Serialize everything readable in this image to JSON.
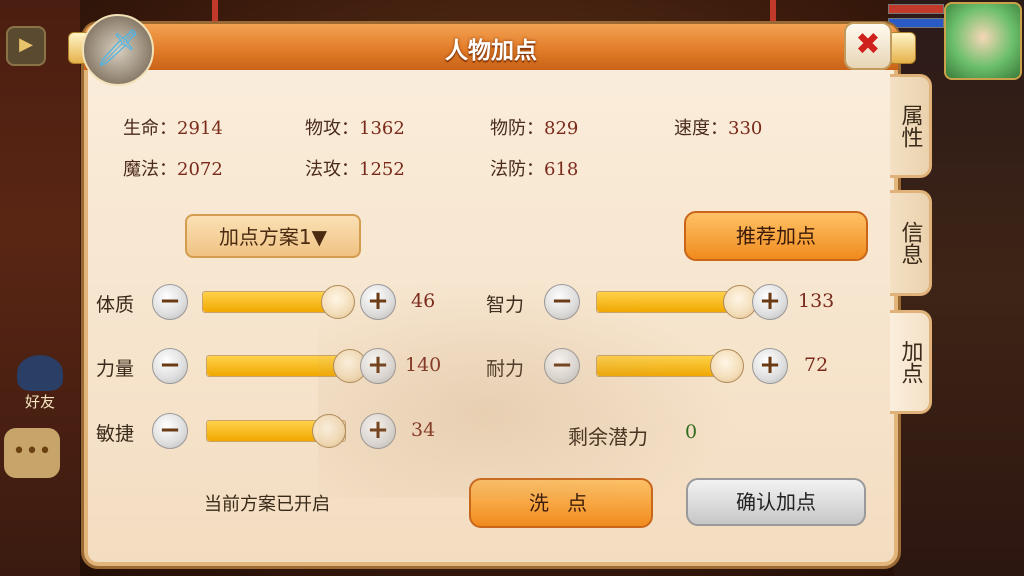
{
  "window": {
    "title": "人物加点"
  },
  "stats": [
    {
      "label": "生命：",
      "value": "2914"
    },
    {
      "label": "物攻：",
      "value": "1362"
    },
    {
      "label": "物防：",
      "value": "829"
    },
    {
      "label": "速度：",
      "value": "330"
    },
    {
      "label": "魔法：",
      "value": "2072"
    },
    {
      "label": "法攻：",
      "value": "1252"
    },
    {
      "label": "法防：",
      "value": "618"
    }
  ],
  "buttons": {
    "plan": "加点方案1▼",
    "recommend": "推荐加点",
    "wash": "洗 点",
    "confirm": "确认加点"
  },
  "attributes": [
    {
      "label": "体质",
      "value": "46",
      "fill": 0.92
    },
    {
      "label": "力量",
      "value": "140",
      "fill": 0.96
    },
    {
      "label": "敏捷",
      "value": "34",
      "fill": 0.88
    },
    {
      "label": "智力",
      "value": "133",
      "fill": 0.96
    },
    {
      "label": "耐力",
      "value": "72",
      "fill": 0.92
    }
  ],
  "remaining": {
    "label": "剩余潜力",
    "value": "0"
  },
  "status_text": "当前方案已开启",
  "tabs": [
    {
      "label": "属性"
    },
    {
      "label": "信息"
    },
    {
      "label": "加点"
    }
  ],
  "sidebar": {
    "friend_label": "好友",
    "chat_glyph": "•••"
  },
  "icons": {
    "minus": "−",
    "plus": "+",
    "close": "✖",
    "weapon": "🗡",
    "play": "▶"
  },
  "colors": {
    "title_bar": "#e37d29",
    "slider_fill": "#f0a800",
    "panel_bg": "#f6e4cc",
    "close_x": "#d0201c"
  }
}
